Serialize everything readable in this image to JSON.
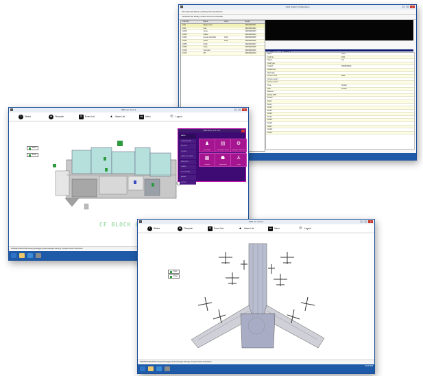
{
  "config_window": {
    "title": "Card Holder Configuration",
    "toolbar_label": "Print  Title  Field  Delete  Load  Save  Print  Exit  Refresh",
    "sub_label": "Card/Staff  Title   Modify  Location Access  Card Details",
    "grid_columns": [
      "Card No",
      "Name",
      "Issue",
      "Expiry"
    ],
    "grid_rows": [
      [
        "1001",
        "Master Card",
        "",
        "000000000001"
      ],
      [
        "1002",
        "User",
        "",
        "000000000002"
      ],
      [
        "10003",
        "Jones",
        "",
        "000000000003"
      ],
      [
        "10034",
        "Clarke",
        "",
        "000000000004"
      ],
      [
        "10041",
        "Access Controller",
        "1142",
        "000000000005"
      ],
      [
        "10044",
        "Visitor",
        "1143",
        "000000000006"
      ],
      [
        "10053",
        "Smith",
        "",
        "000000000007"
      ],
      [
        "10087",
        "Temp",
        "",
        "000000000008"
      ],
      [
        "10100",
        "Test Card",
        "",
        "000000000009"
      ],
      [
        "10101",
        "GH",
        "",
        "000000000010"
      ]
    ],
    "buttons": [
      "Add",
      "Delete"
    ],
    "detail_rows": [
      [
        "Name",
        "Value"
      ],
      [
        "Card No",
        "1001"
      ],
      [
        "Status",
        "Yes"
      ],
      [
        "Card Type",
        ""
      ],
      [
        "Card ID",
        "00000000001"
      ],
      [
        "Department",
        ""
      ],
      [
        "Start Date",
        ""
      ],
      [
        "Access Level",
        "0001"
      ],
      [
        "Access Level 2",
        ""
      ],
      [
        "Access Level 3",
        ""
      ],
      [
        "Time",
        "Normal"
      ],
      [
        "Shift",
        "Normal"
      ],
      [
        "Reserve",
        ""
      ],
      [
        "Enable APB",
        ""
      ],
      [
        "Duress",
        ""
      ],
      [
        "Expiry",
        ""
      ],
      [
        "Doors",
        ""
      ],
      [
        "Field 1",
        ""
      ],
      [
        "Field 2",
        ""
      ],
      [
        "Field 3",
        ""
      ],
      [
        "Field 4",
        ""
      ],
      [
        "Field 5",
        ""
      ],
      [
        "Field 6",
        ""
      ],
      [
        "Field 7",
        ""
      ],
      [
        "Field 8",
        ""
      ],
      [
        "Field 9",
        ""
      ]
    ]
  },
  "floorplan_window": {
    "title": "ORS ver 3.0.0.1",
    "toolbar": [
      {
        "label": "Status",
        "icon": "info-icon"
      },
      {
        "label": "Floorplan",
        "icon": "location-pin-icon"
      },
      {
        "label": "Event List",
        "icon": "list-icon"
      },
      {
        "label": "Alarm List",
        "icon": "bell-icon"
      },
      {
        "label": "Menu",
        "icon": "menu-icon"
      },
      {
        "label": "Logout",
        "icon": "power-icon"
      }
    ],
    "legend": [
      "Door",
      "Zone"
    ],
    "block_label": "CF BLOCK C",
    "status_text": "ORS/DEVICE/STATE  Area(s)  Message(s) Acknowledged  Alarm(s)  Occupied Hosts  Total Hosts",
    "popup": {
      "title": "ORS Menu ver 3.0.0.1",
      "menu_items": [
        "MENU",
        "CONTROLLER",
        "ACCESS",
        "DOORS",
        "CARD HOLDERS",
        "REPORTS",
        "USERS",
        "FLOORPLAN",
        "AREAS",
        "SETUP"
      ],
      "tiles": [
        {
          "label": "Card Holder",
          "icon": "person-icon"
        },
        {
          "label": "Door Access Group",
          "icon": "door-icon"
        },
        {
          "label": "Settings & Floor Plan",
          "icon": "gear-icon"
        },
        {
          "label": "Calendar",
          "icon": "calendar-icon"
        },
        {
          "label": "Organization",
          "icon": "org-icon"
        },
        {
          "label": "Users",
          "icon": "user-icon"
        }
      ]
    }
  },
  "airport_window": {
    "title": "ORS ver 3.0.0.1",
    "toolbar": [
      {
        "label": "Status",
        "icon": "info-icon"
      },
      {
        "label": "Floorplan",
        "icon": "location-pin-icon"
      },
      {
        "label": "Event List",
        "icon": "list-icon"
      },
      {
        "label": "Alarm List",
        "icon": "bell-icon"
      },
      {
        "label": "Menu",
        "icon": "menu-icon"
      },
      {
        "label": "Logout",
        "icon": "power-icon"
      }
    ],
    "legend": [
      "Door",
      "Zone"
    ],
    "status_text": "ORS/DEVICE/STATE  Area(s)  Message(s) Acknowledged  Alarm(s)  Occupied Hosts  Total Hosts",
    "clock": "12:00 PM"
  },
  "colors": {
    "window_border": "#1c4f9a",
    "taskbar": "#1f5aa8",
    "popup_bg": "#3e0a73",
    "popup_tile": "#a4158f",
    "close_button": "#c93b2e",
    "floor_rooms": "#b6e0dc",
    "block_label": "#7fd08a"
  }
}
